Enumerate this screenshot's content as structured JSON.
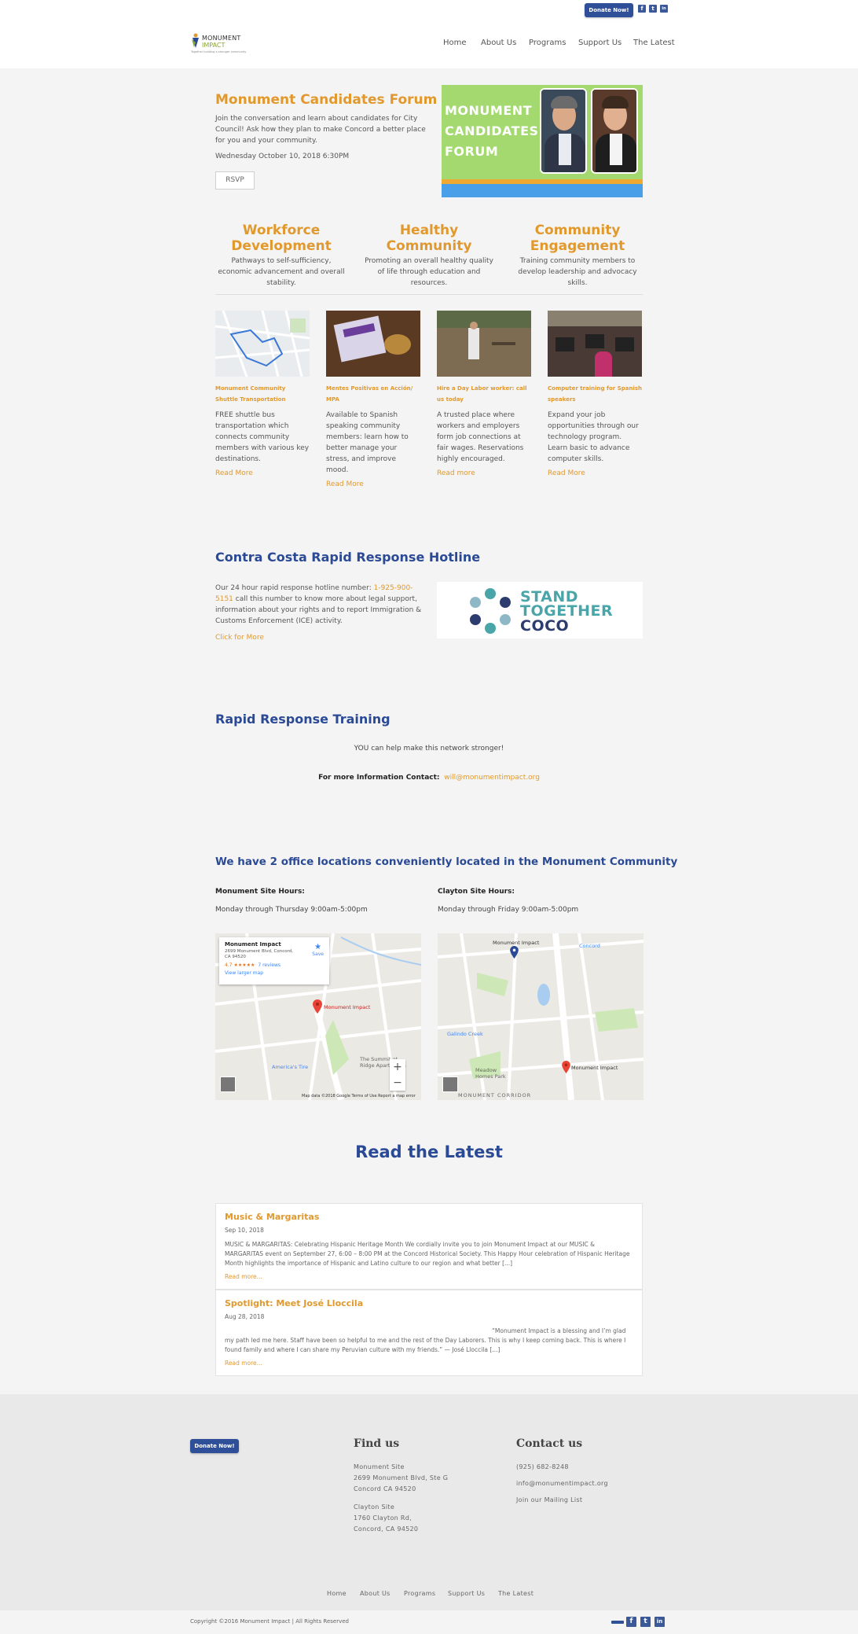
{
  "header": {
    "donate_label": "Donate Now!",
    "social": [
      "f",
      "t",
      "in"
    ],
    "logo": {
      "line1": "MONUMENT",
      "line2": "IMPACT",
      "tagline": "Together building a stronger community"
    },
    "nav": [
      "Home",
      "About Us",
      "Programs",
      "Support Us",
      "The Latest"
    ]
  },
  "hero": {
    "title": "Monument Candidates Forum",
    "description": "Join the conversation and learn about candidates for City Council! Ask how they plan to make Concord a better place for you and your community.",
    "date": "Wednesday October 10, 2018  6:30PM",
    "rsvp_label": "RSVP",
    "banner_text": "MONUMENT CANDIDATES FORUM",
    "colors": {
      "banner": "#a3d96f",
      "stripe_orange": "#f0a931",
      "stripe_blue": "#4aa0e8"
    }
  },
  "pillars": [
    {
      "title": "Workforce Development",
      "text": "Pathways to self-sufficiency, economic advancement and overall stability."
    },
    {
      "title": "Healthy Community",
      "text": "Promoting an overall healthy quality of life through education and resources."
    },
    {
      "title": "Community Engagement",
      "text": "Training community members to develop leadership and advocacy skills."
    }
  ],
  "programs": [
    {
      "title": "Monument Community Shuttle Transportation",
      "desc": "FREE shuttle bus transportation which connects community members with various key destinations.",
      "more": "Read More"
    },
    {
      "title": "Mentes Positivas en Acción/ MPA",
      "desc": "Available to Spanish speaking community members: learn how to better manage your stress, and improve mood.",
      "more": "Read More"
    },
    {
      "title": "Hire a Day Labor worker: call us today",
      "desc": "A trusted place where workers and employers form job connections at fair wages. Reservations highly encouraged.",
      "more": "Read more"
    },
    {
      "title": "Computer training for Spanish speakers",
      "desc": "Expand your job opportunities through our technology program. Learn basic to advance computer skills.",
      "more": "Read More"
    }
  ],
  "hotline": {
    "title": "Contra Costa Rapid Response Hotline",
    "text_before": "Our 24 hour rapid response hotline number: ",
    "phone": "1-925-900-5151",
    "text_after": " call this number to know more about legal support, information about your rights and to report Immigration & Customs Enforcement (ICE) activity.",
    "more": "Click for More",
    "logo_lines": [
      "STAND",
      "TOGETHER",
      "COCO"
    ]
  },
  "training": {
    "title": "Rapid Response Training",
    "sub": "YOU can help make this network stronger!",
    "contact_label": "For more Information Contact:",
    "email": "will@monumentimpact.org"
  },
  "offices": {
    "title": "We have 2 office locations conveniently located in the Monument Community",
    "sites": [
      {
        "label": "Monument Site Hours:",
        "hours": "Monday through Thursday 9:00am-5:00pm"
      },
      {
        "label": "Clayton Site Hours:",
        "hours": "Monday through Friday 9:00am-5:00pm"
      }
    ],
    "map1": {
      "card_name": "Monument Impact",
      "card_address": "2699 Monument Blvd, Concord, CA 94520",
      "rating": "4.7 ★★★★★",
      "reviews": "7 reviews",
      "view_larger": "View larger map",
      "save": "Save",
      "pin_label": "Monument Impact",
      "poi1": "America's Tire",
      "poi2": "The Summit at Ridge Apartments",
      "footer": "Map data ©2018 Google   Terms of Use   Report a map error"
    },
    "map2": {
      "pin_top": "Monument Impact",
      "pin_bottom": "Monument Impact",
      "area1": "Galindo Creek",
      "area2": "Meadow Homes Park",
      "area3": "MONUMENT CORRIDOR",
      "area4": "Concord"
    }
  },
  "latest": {
    "title": "Read the Latest",
    "posts": [
      {
        "title": "Music & Margaritas",
        "date": "Sep 10, 2018",
        "excerpt": "MUSIC & MARGARITAS: Celebrating Hispanic Heritage Month We cordially invite you to join Monument Impact at our MUSIC & MARGARITAS event on September 27, 6:00 – 8:00 PM at the Concord Historical Society. This Happy Hour celebration of Hispanic Heritage Month highlights the importance of Hispanic and Latino culture to our region and what better [...]",
        "more": "Read more..."
      },
      {
        "title": "Spotlight: Meet José Lloccila",
        "date": "Aug 28, 2018",
        "excerpt": "“Monument Impact is a blessing and I’m glad my path led me here. Staff have been so helpful to me and the rest of the Day Laborers. This is why I keep coming back. This is where I found family and where I can share my Peruvian culture with my friends.” — José Lloccila [...]",
        "more": "Read more..."
      }
    ]
  },
  "footer": {
    "donate_label": "Donate Now!",
    "find_title": "Find us",
    "find_lines1": [
      "Monument Site",
      "2699 Monument Blvd, Ste G",
      "Concord CA 94520"
    ],
    "find_lines2": [
      "Clayton Site",
      "1760 Clayton Rd,",
      "Concord, CA 94520"
    ],
    "contact_title": "Contact us",
    "phone": "(925) 682-8248",
    "email": "info@monumentimpact.org",
    "mailing": "Join our Mailing List",
    "nav": [
      "Home",
      "About Us",
      "Programs",
      "Support Us",
      "The Latest"
    ],
    "copyright": "Copyright ©2016 Monument Impact | All Rights Reserved"
  }
}
